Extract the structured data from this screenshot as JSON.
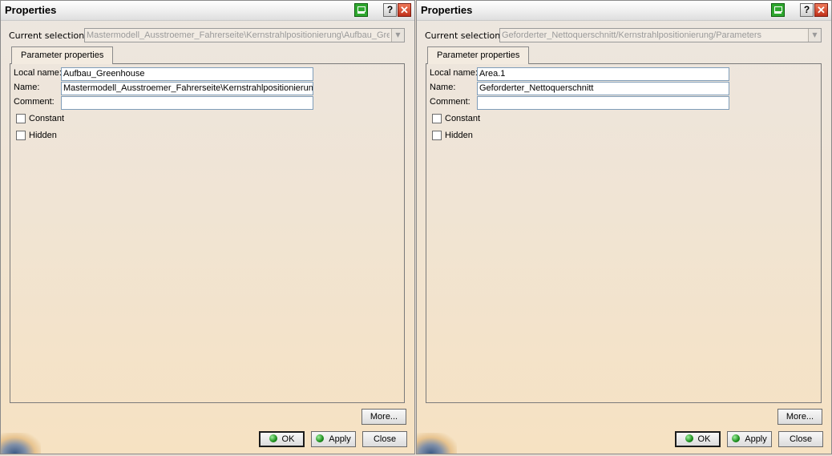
{
  "dialogs": [
    {
      "title": "Properties",
      "current_selection_label": "Current selection :",
      "current_selection_value": "Mastermodell_Ausstroemer_Fahrerseite\\Kernstrahlpositionierung\\Aufbau_Greenhouse",
      "tab_label": "Parameter properties",
      "local_name_label": "Local name:",
      "local_name_value": "Aufbau_Greenhouse",
      "name_label": "Name:",
      "name_value": "Mastermodell_Ausstroemer_Fahrerseite\\Kernstrahlpositionierung",
      "comment_label": "Comment:",
      "comment_value": "",
      "constant_label": "Constant",
      "hidden_label": "Hidden",
      "more_button": "More...",
      "ok_button": "OK",
      "apply_button": "Apply",
      "close_button": "Close",
      "help_icon": "?",
      "close_icon": "✕"
    },
    {
      "title": "Properties",
      "current_selection_label": "Current selection :",
      "current_selection_value": "Geforderter_Nettoquerschnitt/Kernstrahlpositionierung/Parameters",
      "tab_label": "Parameter properties",
      "local_name_label": "Local name:",
      "local_name_value": "Area.1",
      "name_label": "Name:",
      "name_value": "Geforderter_Nettoquerschnitt",
      "comment_label": "Comment:",
      "comment_value": "",
      "constant_label": "Constant",
      "hidden_label": "Hidden",
      "more_button": "More...",
      "ok_button": "OK",
      "apply_button": "Apply",
      "close_button": "Close",
      "help_icon": "?",
      "close_icon": "✕"
    }
  ],
  "icons": {
    "titlebar_app": "green-screen-icon",
    "help": "help-icon",
    "close": "close-icon",
    "ok": "green-ball-icon",
    "apply": "green-ball-icon",
    "corner": "sun-corner-icon"
  },
  "colors": {
    "dialog_top": "#ece6e0",
    "dialog_bottom": "#f6e2c2",
    "disabled_text": "#9a9a9a",
    "input_border": "#7f9db9"
  }
}
